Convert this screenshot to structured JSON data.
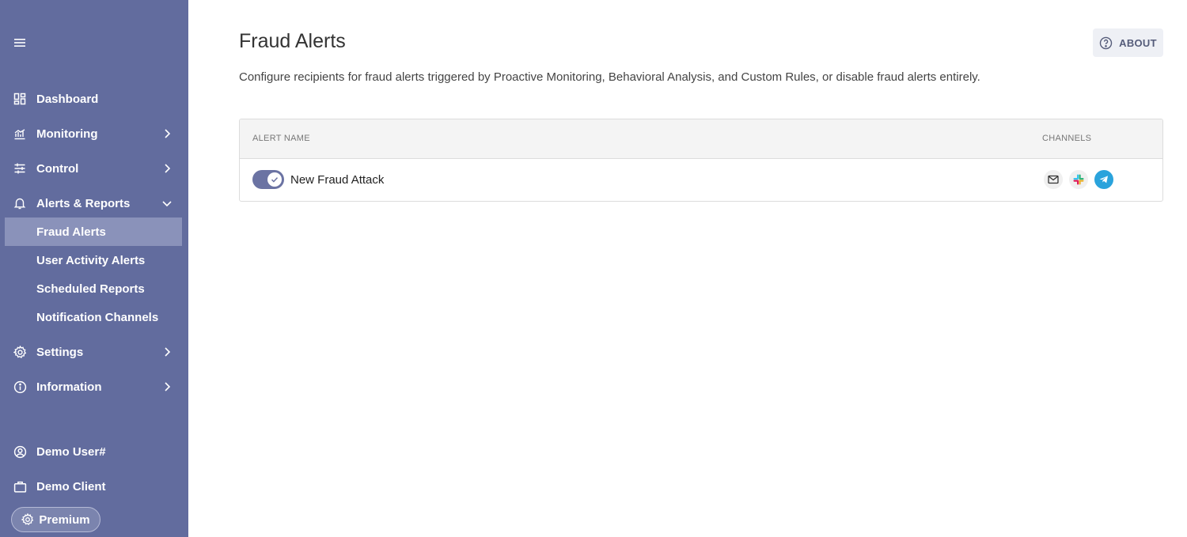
{
  "sidebar": {
    "menu_icon": "hamburger-icon",
    "items": [
      {
        "label": "Dashboard",
        "icon": "dashboard-icon"
      },
      {
        "label": "Monitoring",
        "icon": "chart-icon"
      },
      {
        "label": "Control",
        "icon": "sliders-icon"
      },
      {
        "label": "Alerts & Reports",
        "icon": "bell-icon"
      },
      {
        "label": "Settings",
        "icon": "gear-icon"
      },
      {
        "label": "Information",
        "icon": "info-icon"
      }
    ],
    "sub_items": [
      {
        "label": "Fraud Alerts",
        "active": true
      },
      {
        "label": "User Activity Alerts"
      },
      {
        "label": "Scheduled Reports"
      },
      {
        "label": "Notification Channels"
      }
    ],
    "user": {
      "label": "Demo User#",
      "icon": "user-circle-icon"
    },
    "client": {
      "label": "Demo Client",
      "icon": "briefcase-icon"
    },
    "plan": {
      "label": "Premium",
      "icon": "gear-icon"
    },
    "colors": {
      "background": "#626c9e",
      "active": "#8a92ba"
    }
  },
  "main": {
    "title": "Fraud Alerts",
    "about_label": "ABOUT",
    "description": "Configure recipients for fraud alerts triggered by Proactive Monitoring, Behavioral Analysis, and Custom Rules, or disable fraud alerts entirely.",
    "table": {
      "columns": [
        "ALERT NAME",
        "CHANNELS"
      ],
      "rows": [
        {
          "name": "New Fraud Attack",
          "enabled": true,
          "channels": [
            "email-icon",
            "slack-icon",
            "telegram-icon"
          ]
        }
      ]
    }
  }
}
